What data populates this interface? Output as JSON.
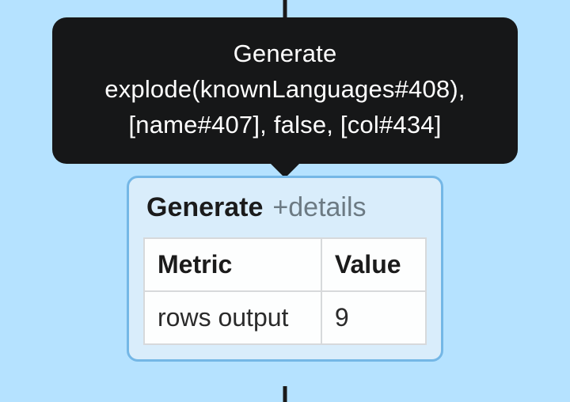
{
  "tooltip": {
    "line1": "Generate",
    "line2": "explode(knownLanguages#408),",
    "line3": "[name#407], false, [col#434]"
  },
  "node": {
    "title": "Generate",
    "details_label": "+details"
  },
  "metrics": {
    "header_metric": "Metric",
    "header_value": "Value",
    "rows": [
      {
        "metric": "rows output",
        "value": "9"
      }
    ]
  }
}
